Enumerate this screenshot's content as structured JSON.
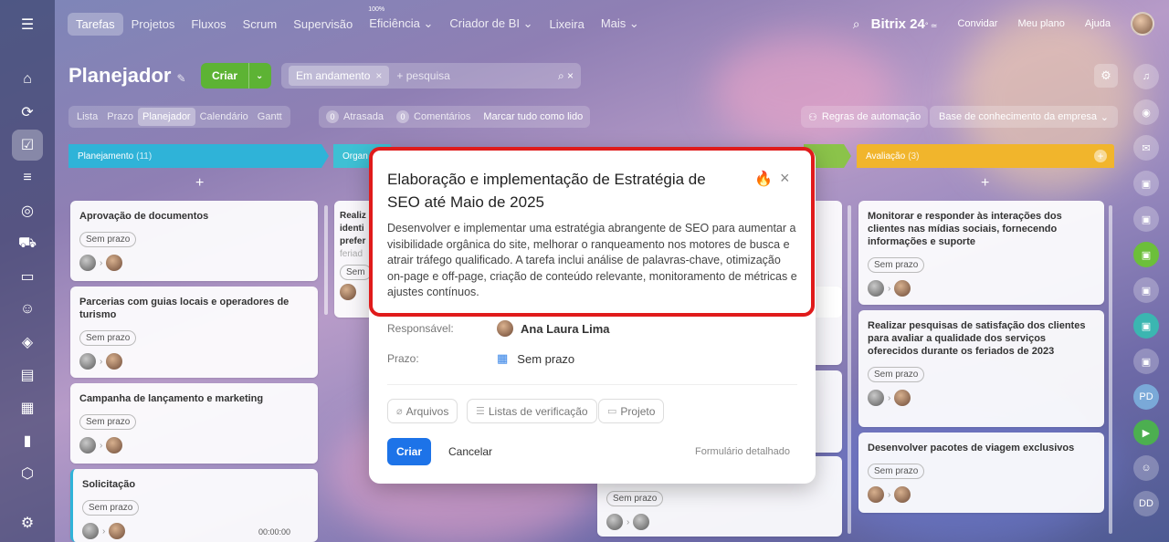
{
  "topnav": {
    "items": [
      "Tarefas",
      "Projetos",
      "Fluxos",
      "Scrum",
      "Supervisão",
      "Eficiência",
      "Criador de BI",
      "Lixeira",
      "Mais"
    ],
    "efficiency_sup": "100%",
    "brand": "Bitrix 24",
    "brand_suffix": "° ≃",
    "invite": "Convidar",
    "plan": "Meu plano",
    "help": "Ajuda"
  },
  "header": {
    "title": "Planejador",
    "create_label": "Criar",
    "filter_chip": "Em andamento",
    "search_placeholder": "+ pesquisa"
  },
  "views": [
    "Lista",
    "Prazo",
    "Planejador",
    "Calendário",
    "Gantt"
  ],
  "counters": {
    "overdue_count": "0",
    "overdue_label": "Atrasada",
    "comments_count": "0",
    "comments_label": "Comentários",
    "mark_all": "Marcar tudo como lido"
  },
  "automation": "Regras de automação",
  "knowledge_base": "Base de conhecimento da empresa",
  "columns": {
    "planning": {
      "title": "Planejamento",
      "count": "(11)"
    },
    "org": {
      "title": "Organ"
    },
    "review": {
      "title": "Avaliação",
      "count": "(3)"
    }
  },
  "cards": {
    "p1": "Aprovação de documentos",
    "p2": "Parcerias com guias locais e operadores de turismo",
    "p3": "Campanha de lançamento e marketing",
    "p4": "Solicitação",
    "p4_timer": "00:00:00",
    "o1_l1": "Realiz",
    "o1_l2": "identi",
    "o1_l3": "prefer",
    "o1_l4": "feriad",
    "o1_badge": "Sem",
    "m_badge": "Sem prazo",
    "r1": "Monitorar e responder às interações dos clientes nas mídias sociais, fornecendo informações e suporte",
    "r2": "Realizar pesquisas de satisfação dos clientes para avaliar a qualidade dos serviços oferecidos durante os feriados de 2023",
    "r3": "Desenvolver pacotes de viagem exclusivos",
    "no_deadline": "Sem prazo"
  },
  "modal": {
    "title": "Elaboração e implementação de Estratégia de SEO até Maio de 2025",
    "description": "Desenvolver e implementar uma estratégia abrangente de SEO para aumentar a visibilidade orgânica do site, melhorar o ranqueamento nos motores de busca e atrair tráfego qualificado. A tarefa inclui análise de palavras-chave, otimização on-page e off-page, criação de conteúdo relevante, monitoramento de métricas e ajustes contínuos.",
    "responsible_label": "Responsável:",
    "responsible_value": "Ana Laura Lima",
    "deadline_label": "Prazo:",
    "deadline_value": "Sem prazo",
    "files": "Arquivos",
    "checklists": "Listas de verificação",
    "project": "Projeto",
    "create": "Criar",
    "cancel": "Cancelar",
    "detailed_form": "Formulário detalhado"
  },
  "right_rail": {
    "pd": "PD",
    "dd": "DD"
  },
  "colors": {
    "highlight": "#e01b1b",
    "primary": "#1d73e8",
    "green": "#5db334",
    "planning_head": "#2fb3d8",
    "org_head": "#3ec0d4",
    "review_head": "#f1b52c"
  }
}
